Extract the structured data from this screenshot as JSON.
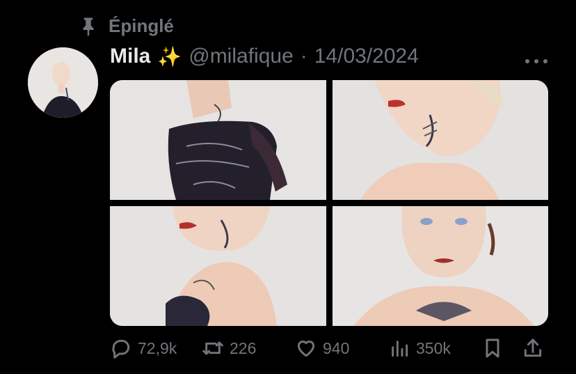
{
  "pinned": {
    "label": "Épinglé",
    "icon": "pin-icon"
  },
  "tweet": {
    "author_name": "Mila",
    "emoji": "✨",
    "handle": "@milafique",
    "separator": "·",
    "date": "14/03/2024",
    "media_count": 4
  },
  "actions": {
    "replies": "72,9k",
    "retweets": "226",
    "likes": "940",
    "views": "350k"
  },
  "colors": {
    "background": "#000000",
    "muted": "#71767b",
    "text": "#e7e9ea"
  }
}
